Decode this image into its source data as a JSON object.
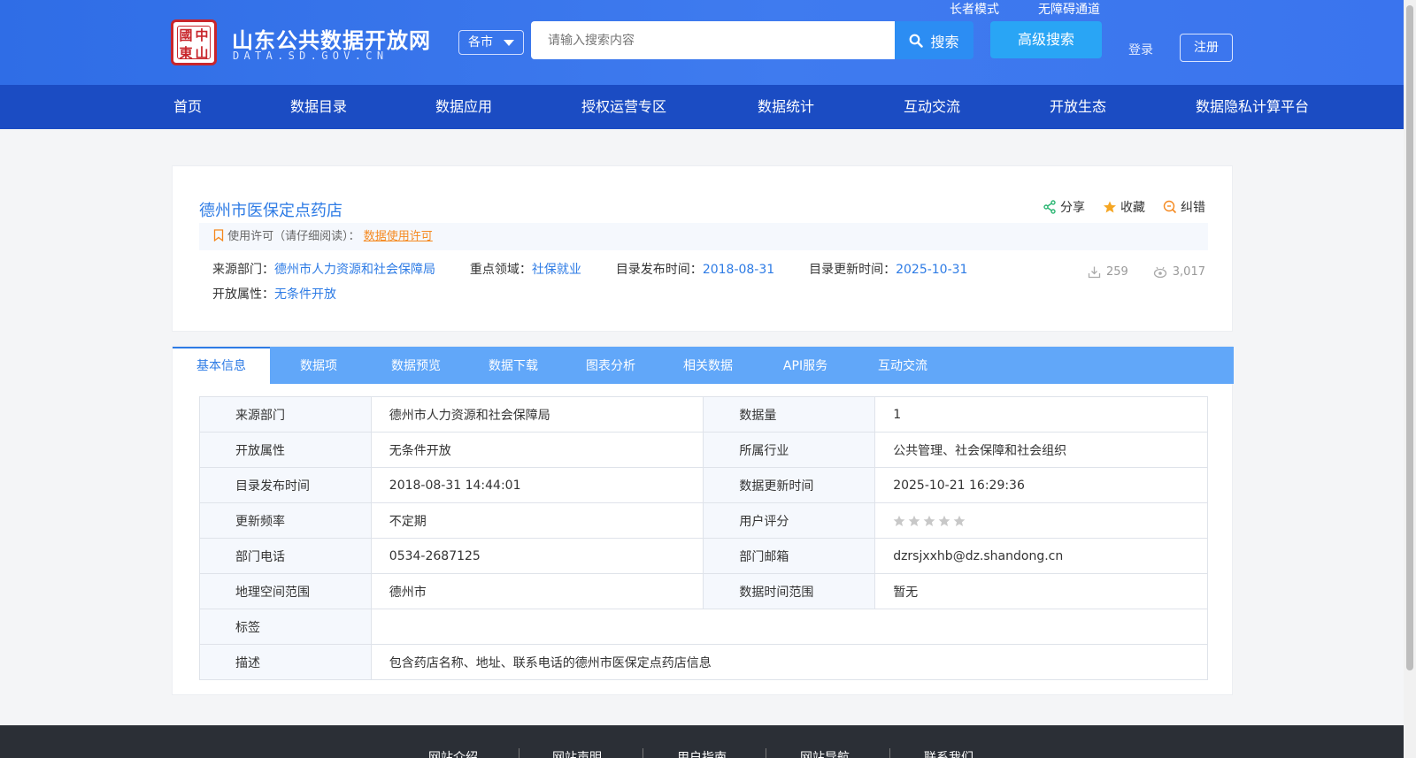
{
  "header": {
    "logo_seal": [
      "中",
      "國",
      "山",
      "東"
    ],
    "site_title": "山东公共数据开放网",
    "site_domain": "DATA.SD.GOV.CN",
    "city_select": "各市",
    "search_placeholder": "请输入搜索内容",
    "search_button": "搜索",
    "advanced_search": "高级搜索",
    "elder_mode": "长者模式",
    "accessibility": "无障碍通道",
    "login": "登录",
    "register": "注册"
  },
  "nav": [
    "首页",
    "数据目录",
    "数据应用",
    "授权运营专区",
    "数据统计",
    "互动交流",
    "开放生态",
    "数据隐私计算平台"
  ],
  "dataset": {
    "title": "德州市医保定点药店",
    "actions": {
      "share": "分享",
      "favorite": "收藏",
      "report": "纠错"
    },
    "license_label": "使用许可（请仔细阅读）：",
    "license_link": "数据使用许可",
    "meta": {
      "source_label": "来源部门：",
      "source_value": "德州市人力资源和社会保障局",
      "field_label": "重点领域：",
      "field_value": "社保就业",
      "publish_label": "目录发布时间：",
      "publish_value": "2018-08-31",
      "update_label": "目录更新时间：",
      "update_value": "2025-10-31",
      "open_label": "开放属性：",
      "open_value": "无条件开放"
    },
    "downloads": "259",
    "views": "3,017"
  },
  "tabs": [
    "基本信息",
    "数据项",
    "数据预览",
    "数据下载",
    "图表分析",
    "相关数据",
    "API服务",
    "互动交流"
  ],
  "info_table": {
    "rows": [
      [
        "来源部门",
        "德州市人力资源和社会保障局",
        "数据量",
        "1"
      ],
      [
        "开放属性",
        "无条件开放",
        "所属行业",
        "公共管理、社会保障和社会组织"
      ],
      [
        "目录发布时间",
        "2018-08-31 14:44:01",
        "数据更新时间",
        "2025-10-21 16:29:36"
      ],
      [
        "更新频率",
        "不定期",
        "用户评分",
        ""
      ],
      [
        "部门电话",
        "0534-2687125",
        "部门邮箱",
        "dzrsjxxhb@dz.shandong.cn"
      ],
      [
        "地理空间范围",
        "德州市",
        "数据时间范围",
        "暂无"
      ]
    ],
    "tags_label": "标签",
    "tags_value": "",
    "desc_label": "描述",
    "desc_value": "包含药店名称、地址、联系电话的德州市医保定点药店信息",
    "rating_stars": 5,
    "rating_value": 0
  },
  "footer": [
    "网站介绍",
    "网站声明",
    "用户指南",
    "网站导航",
    "联系我们"
  ],
  "colors": {
    "header": "#2f6de6",
    "nav": "#1b4cc3",
    "tabs": "#61a7f9",
    "accent": "#2d7be5",
    "license": "#f5891f"
  }
}
